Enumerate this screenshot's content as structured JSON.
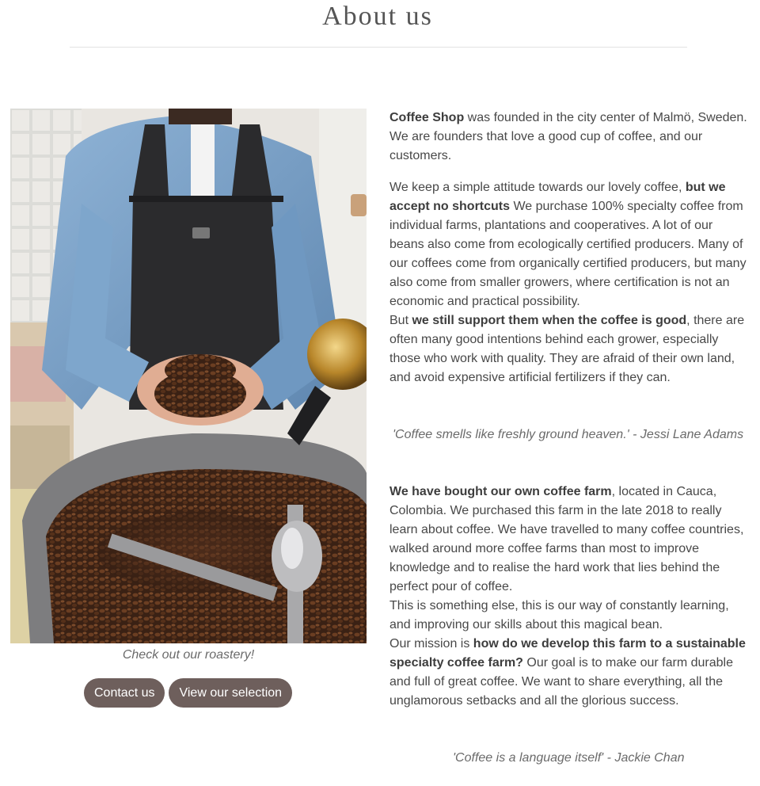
{
  "header": {
    "title": "About us"
  },
  "photo": {
    "description_icon": "coffee-roaster-photo"
  },
  "caption": "Check out our roastery!",
  "buttons": {
    "contact": "Contact us",
    "selection": "View our selection"
  },
  "intro": {
    "p1_bold": "Coffee Shop",
    "p1_rest": " was founded in the city center of Malmö, Sweden. We are founders that love a good cup of coffee, and our customers.",
    "p2_a": "We keep a simple attitude towards our lovely coffee, ",
    "p2_bold": "but we accept no shortcuts",
    "p2_b": " We purchase 100% specialty coffee from individual farms, plantations and cooperatives. A lot of our beans also come from ecologically certified producers. Many of our coffees come from organically certified producers, but many also come from smaller growers, where certification is not an economic and practical possibility.",
    "p3_a": "But ",
    "p3_bold": "we still support them when the coffee is good",
    "p3_b": ", there are often many good intentions behind each grower, especially those who work with quality. They are afraid of their own land, and avoid expensive artificial fertilizers if they can."
  },
  "quotes": {
    "first": "'Coffee smells like freshly ground heaven.' - Jessi Lane Adams",
    "second": "'Coffee is a language itself' - Jackie Chan"
  },
  "farm": {
    "p1_bold": "We have bought our own coffee farm",
    "p1_rest": ", located in Cauca, Colombia. We purchased this farm in the late 2018 to really learn about coffee. We have travelled to many coffee countries, walked around more coffee farms than most to improve knowledge and to realise the hard work that lies behind the perfect pour of coffee.",
    "p2": "This is something else, this is our way of constantly learning, and improving our skills about this magical bean.",
    "p3_a": "Our mission is ",
    "p3_bold": "how do we develop this farm to a sustainable specialty coffee farm?",
    "p3_b": " Our goal is to make our farm durable and full of great coffee. We want to share everything, all the unglamorous setbacks and all the glorious success."
  },
  "colors": {
    "button_bg": "#6e5f5c",
    "button_text": "#ffffff",
    "text": "#484848",
    "quote": "#6a6a6a"
  }
}
